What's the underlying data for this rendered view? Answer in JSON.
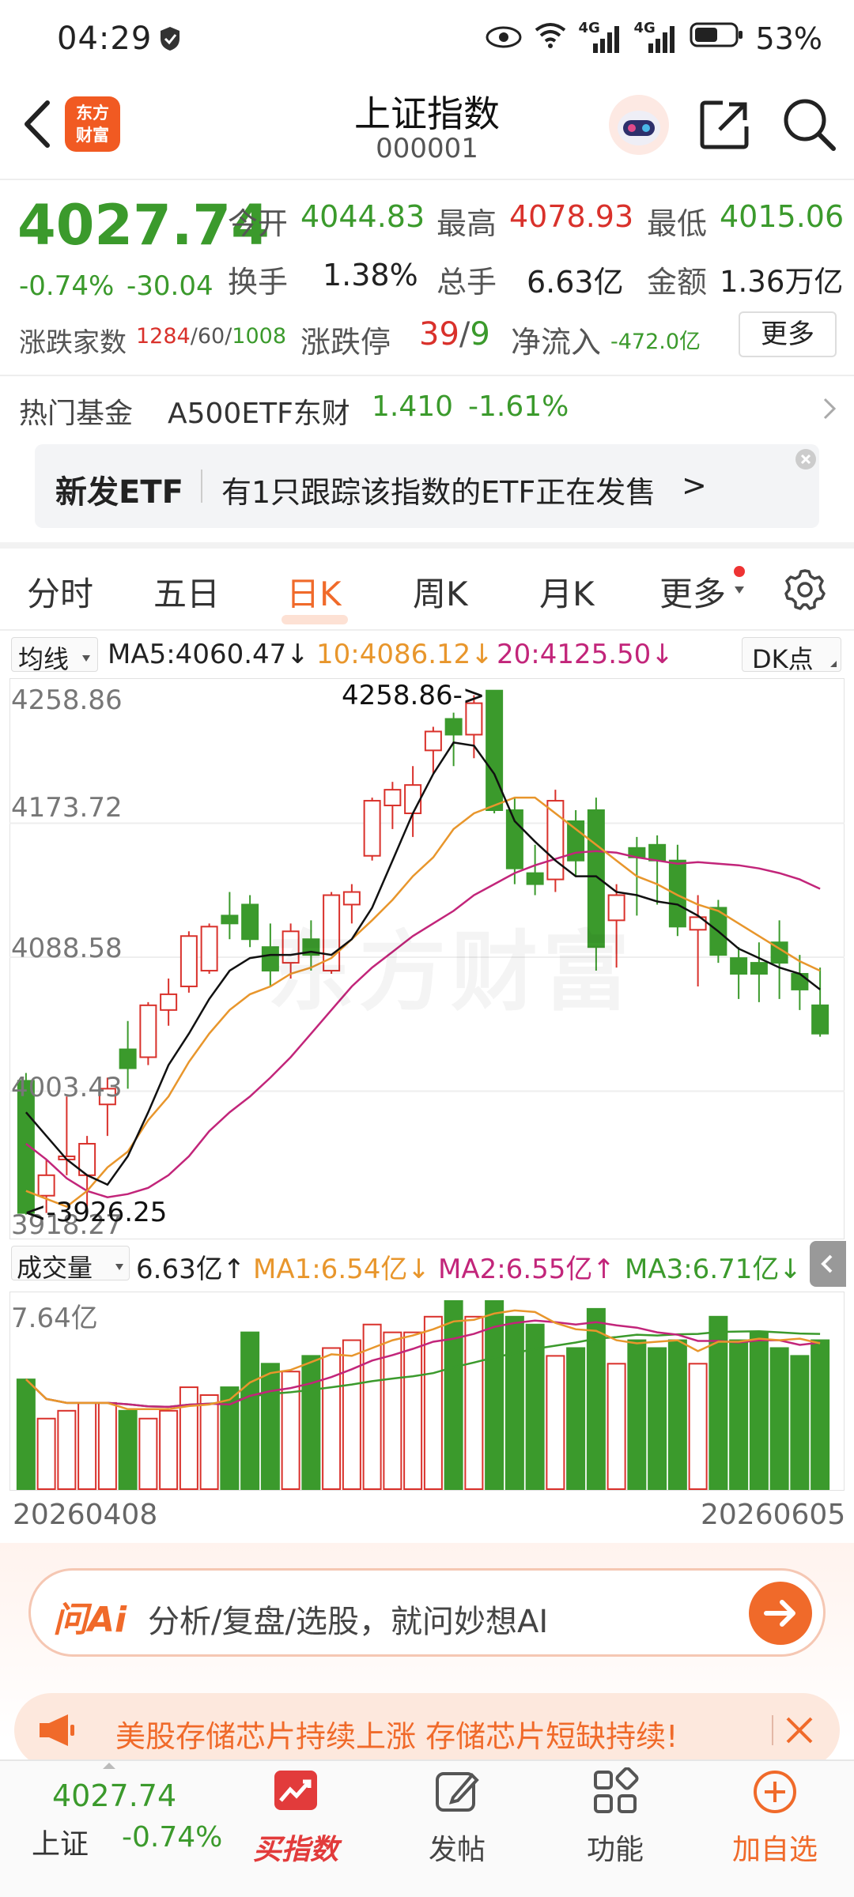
{
  "status": {
    "time": "04:29",
    "network": "4G",
    "network2": "4G",
    "battery": "53%"
  },
  "nav": {
    "title": "上证指数",
    "code": "000001",
    "logo_line1": "东方",
    "logo_line2": "财富"
  },
  "quote": {
    "price": "4027.74",
    "change_pct": "-0.74%",
    "change": "-30.04",
    "open_label": "今开",
    "open": "4044.83",
    "high_label": "最高",
    "high": "4078.93",
    "low_label": "最低",
    "low": "4015.06",
    "turnover_label": "换手",
    "turnover": "1.38%",
    "volume_label": "总手",
    "volume": "6.63亿",
    "amount_label": "金额",
    "amount": "1.36万亿",
    "breadth_label": "涨跌家数",
    "up": "1284",
    "flat": "60",
    "down": "1008",
    "limit_label": "涨跌停",
    "limit_up": "39",
    "limit_down": "9",
    "inflow_label": "净流入",
    "inflow": "-472.0亿",
    "more_button": "更多"
  },
  "hot_fund": {
    "label": "热门基金",
    "name": "A500ETF东财",
    "price": "1.410",
    "pct": "-1.61%"
  },
  "etf_banner": {
    "title": "新发ETF",
    "text": "有1只跟踪该指数的ETF正在发售",
    "arrow": ">"
  },
  "tabs": [
    {
      "label": "分时",
      "active": false
    },
    {
      "label": "五日",
      "active": false
    },
    {
      "label": "日K",
      "active": true
    },
    {
      "label": "周K",
      "active": false
    },
    {
      "label": "月K",
      "active": false
    },
    {
      "label": "更多",
      "active": false
    }
  ],
  "ma_bar": {
    "selector": "均线",
    "ma5": "MA5:4060.47",
    "ma10": "10:4086.12",
    "ma20": "20:4125.50",
    "dk": "DK点"
  },
  "price_axis": [
    "4258.86",
    "4173.72",
    "4088.58",
    "4003.43",
    "3918.27"
  ],
  "chart_labels": {
    "high_marker": "4258.86->",
    "low_marker": "<-3926.25",
    "watermark": "东方财富"
  },
  "volume_bar": {
    "selector": "成交量",
    "vol": "6.63亿",
    "ma1": "MA1:6.54亿",
    "ma2": "MA2:6.55亿",
    "ma3": "MA3:6.71亿",
    "top": "7.64亿"
  },
  "dates": {
    "start": "20260408",
    "end": "20260605"
  },
  "ai_search": {
    "logo": "问Ai",
    "placeholder": "分析/复盘/选股，就问妙想AI"
  },
  "news": {
    "text": "美股存储芯片持续上涨 存储芯片短缺持续!"
  },
  "bottom": {
    "price": "4027.74",
    "name": "上证",
    "pct": "-0.74%",
    "items": [
      {
        "label": "买指数"
      },
      {
        "label": "发帖"
      },
      {
        "label": "功能"
      },
      {
        "label": "加自选"
      }
    ]
  },
  "colors": {
    "up": "#d9312b",
    "down": "#3b9a2c",
    "ma5": "#111111",
    "ma10": "#e8962c",
    "ma20": "#c2257a",
    "accent": "#f06a2a"
  },
  "chart_data": {
    "type": "candlestick",
    "price_range": [
      3918.27,
      4258.86
    ],
    "volume_max": 7.64,
    "candles": [
      {
        "o": 4010,
        "h": 4015,
        "l": 3925,
        "c": 3926,
        "v": 6.6
      },
      {
        "o": 3937,
        "h": 3960,
        "l": 3926,
        "c": 3950,
        "v": 6.1
      },
      {
        "o": 3960,
        "h": 4000,
        "l": 3950,
        "c": 3962,
        "v": 6.2
      },
      {
        "o": 3950,
        "h": 3975,
        "l": 3930,
        "c": 3970,
        "v": 6.3
      },
      {
        "o": 3995,
        "h": 4012,
        "l": 3975,
        "c": 4005,
        "v": 6.3
      },
      {
        "o": 4030,
        "h": 4048,
        "l": 4005,
        "c": 4018,
        "v": 6.2
      },
      {
        "o": 4025,
        "h": 4060,
        "l": 4020,
        "c": 4058,
        "v": 6.1
      },
      {
        "o": 4055,
        "h": 4075,
        "l": 4045,
        "c": 4065,
        "v": 6.2
      },
      {
        "o": 4070,
        "h": 4105,
        "l": 4066,
        "c": 4102,
        "v": 6.5
      },
      {
        "o": 4080,
        "h": 4110,
        "l": 4078,
        "c": 4108,
        "v": 6.4
      },
      {
        "o": 4115,
        "h": 4130,
        "l": 4100,
        "c": 4110,
        "v": 6.5
      },
      {
        "o": 4122,
        "h": 4128,
        "l": 4095,
        "c": 4100,
        "v": 7.2
      },
      {
        "o": 4095,
        "h": 4110,
        "l": 4070,
        "c": 4080,
        "v": 6.8
      },
      {
        "o": 4085,
        "h": 4110,
        "l": 4075,
        "c": 4105,
        "v": 6.7
      },
      {
        "o": 4100,
        "h": 4112,
        "l": 4080,
        "c": 4090,
        "v": 6.9
      },
      {
        "o": 4080,
        "h": 4130,
        "l": 4078,
        "c": 4128,
        "v": 7.0
      },
      {
        "o": 4122,
        "h": 4135,
        "l": 4110,
        "c": 4130,
        "v": 7.1
      },
      {
        "o": 4153,
        "h": 4190,
        "l": 4150,
        "c": 4188,
        "v": 7.3
      },
      {
        "o": 4185,
        "h": 4200,
        "l": 4170,
        "c": 4195,
        "v": 7.2
      },
      {
        "o": 4180,
        "h": 4210,
        "l": 4165,
        "c": 4198,
        "v": 7.2
      },
      {
        "o": 4220,
        "h": 4235,
        "l": 4205,
        "c": 4232,
        "v": 7.4
      },
      {
        "o": 4240,
        "h": 4244,
        "l": 4210,
        "c": 4230,
        "v": 7.6
      },
      {
        "o": 4230,
        "h": 4255,
        "l": 4215,
        "c": 4250,
        "v": 7.4
      },
      {
        "o": 4258,
        "h": 4258,
        "l": 4180,
        "c": 4182,
        "v": 7.6
      },
      {
        "o": 4182,
        "h": 4190,
        "l": 4135,
        "c": 4145,
        "v": 7.4
      },
      {
        "o": 4142,
        "h": 4160,
        "l": 4128,
        "c": 4135,
        "v": 7.3
      },
      {
        "o": 4138,
        "h": 4195,
        "l": 4130,
        "c": 4188,
        "v": 6.9
      },
      {
        "o": 4175,
        "h": 4182,
        "l": 4140,
        "c": 4150,
        "v": 7.0
      },
      {
        "o": 4182,
        "h": 4190,
        "l": 4080,
        "c": 4095,
        "v": 7.5
      },
      {
        "o": 4112,
        "h": 4135,
        "l": 4082,
        "c": 4128,
        "v": 6.8
      },
      {
        "o": 4158,
        "h": 4165,
        "l": 4115,
        "c": 4152,
        "v": 7.1
      },
      {
        "o": 4160,
        "h": 4166,
        "l": 4122,
        "c": 4150,
        "v": 7.0
      },
      {
        "o": 4150,
        "h": 4160,
        "l": 4102,
        "c": 4108,
        "v": 7.1
      },
      {
        "o": 4106,
        "h": 4128,
        "l": 4070,
        "c": 4114,
        "v": 6.8
      },
      {
        "o": 4120,
        "h": 4125,
        "l": 4085,
        "c": 4090,
        "v": 7.4
      },
      {
        "o": 4088,
        "h": 4095,
        "l": 4062,
        "c": 4078,
        "v": 7.1
      },
      {
        "o": 4085,
        "h": 4098,
        "l": 4060,
        "c": 4078,
        "v": 7.2
      },
      {
        "o": 4098,
        "h": 4112,
        "l": 4062,
        "c": 4085,
        "v": 7.0
      },
      {
        "o": 4078,
        "h": 4090,
        "l": 4055,
        "c": 4068,
        "v": 6.9
      },
      {
        "o": 4058,
        "h": 4082,
        "l": 4038,
        "c": 4040,
        "v": 7.1
      }
    ],
    "ma5": [
      3990,
      3975,
      3960,
      3950,
      3944,
      3962,
      3990,
      4020,
      4040,
      4062,
      4080,
      4088,
      4090,
      4090,
      4092,
      4090,
      4100,
      4120,
      4150,
      4180,
      4205,
      4225,
      4223,
      4205,
      4175,
      4162,
      4150,
      4140,
      4140,
      4130,
      4128,
      4124,
      4122,
      4115,
      4105,
      4094,
      4088,
      4082,
      4078,
      4068
    ],
    "ma10": [
      3940,
      3935,
      3930,
      3940,
      3955,
      3965,
      3985,
      4000,
      4022,
      4040,
      4055,
      4065,
      4070,
      4078,
      4082,
      4088,
      4100,
      4112,
      4125,
      4140,
      4152,
      4170,
      4180,
      4185,
      4190,
      4190,
      4180,
      4170,
      4160,
      4150,
      4140,
      4135,
      4128,
      4122,
      4118,
      4110,
      4102,
      4094,
      4086,
      4080
    ],
    "ma20": [
      3970,
      3960,
      3948,
      3940,
      3936,
      3938,
      3942,
      3950,
      3962,
      3978,
      3990,
      4000,
      4012,
      4025,
      4040,
      4055,
      4070,
      4082,
      4092,
      4102,
      4110,
      4118,
      4128,
      4135,
      4142,
      4147,
      4151,
      4155,
      4156,
      4155,
      4152,
      4150,
      4148,
      4149,
      4148,
      4147,
      4145,
      4142,
      4138,
      4132
    ]
  }
}
